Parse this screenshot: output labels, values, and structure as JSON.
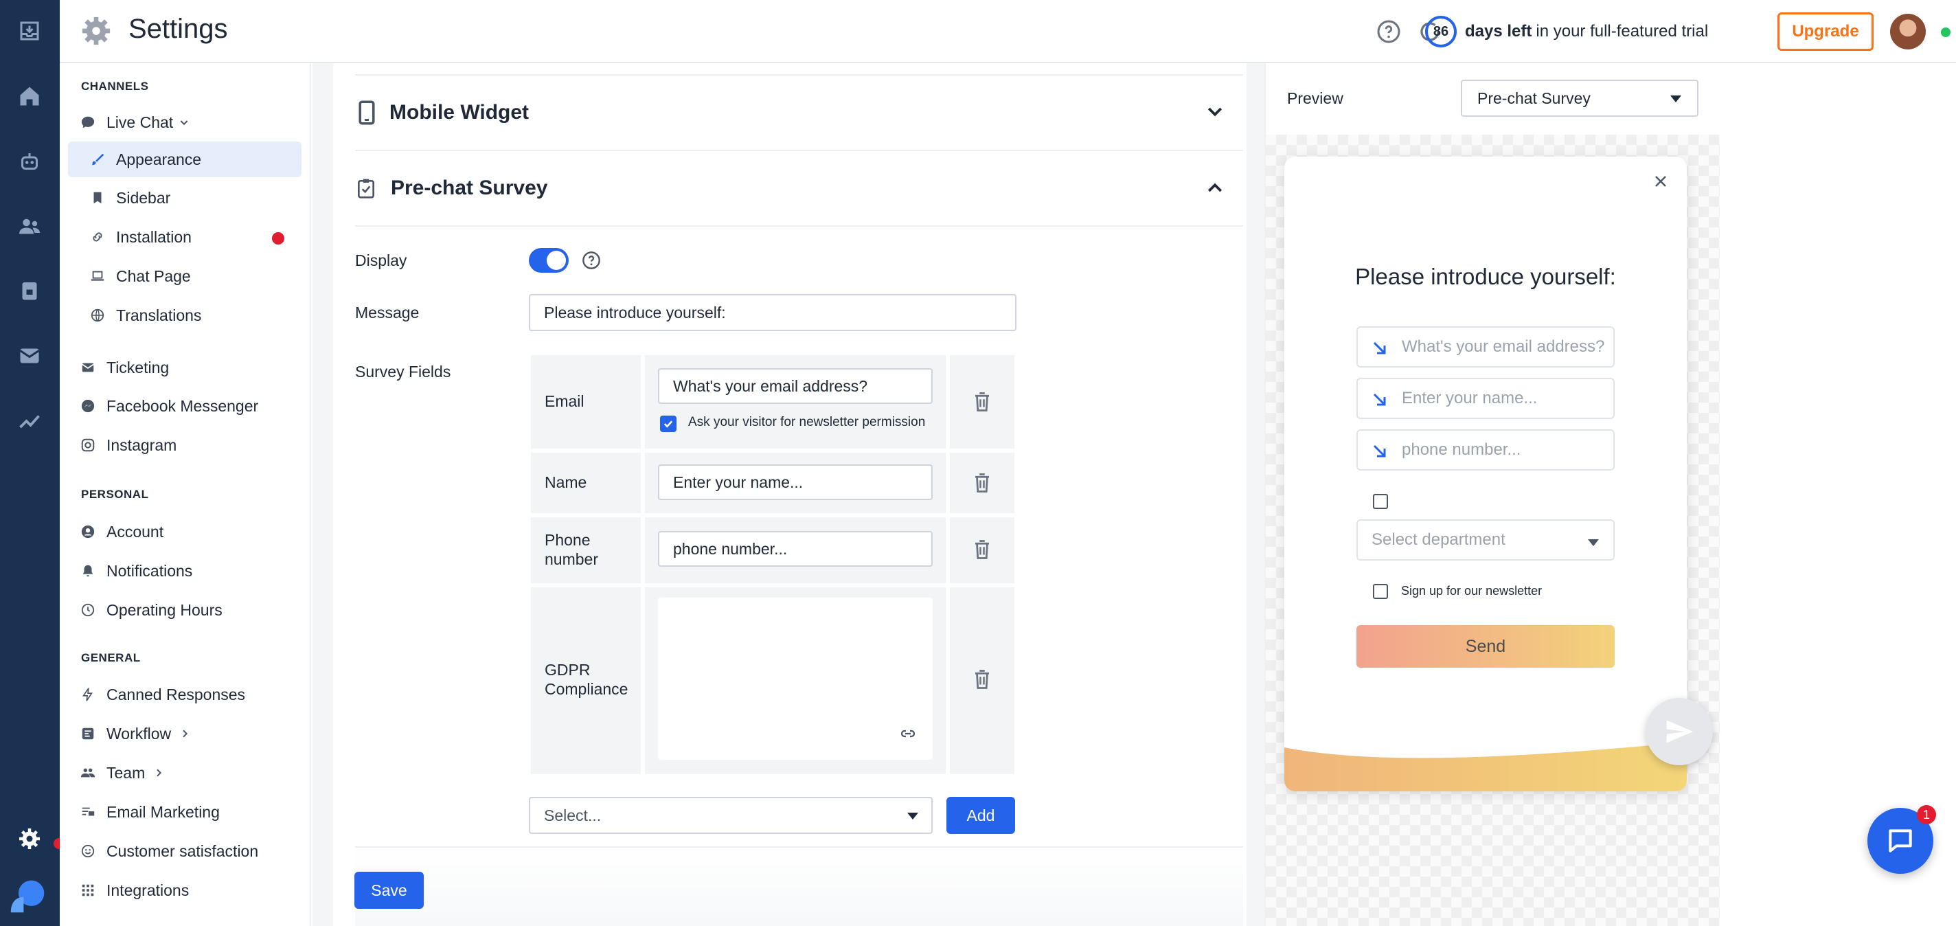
{
  "header": {
    "title": "Settings",
    "trial_days": "86",
    "trial_bold": "days left",
    "trial_rest": "in your full-featured trial",
    "upgrade_label": "Upgrade"
  },
  "sidebar": {
    "sections": {
      "channels": "CHANNELS",
      "personal": "PERSONAL",
      "general": "GENERAL"
    },
    "live_chat": "Live Chat",
    "live_chat_items": [
      "Appearance",
      "Sidebar",
      "Installation",
      "Chat Page",
      "Translations"
    ],
    "channels_items": [
      "Ticketing",
      "Facebook Messenger",
      "Instagram"
    ],
    "personal_items": [
      "Account",
      "Notifications",
      "Operating Hours"
    ],
    "general_items": [
      "Canned Responses",
      "Workflow",
      "Team",
      "Email Marketing",
      "Customer satisfaction",
      "Integrations"
    ]
  },
  "main": {
    "mobile_widget": "Mobile Widget",
    "prechat_survey": "Pre-chat Survey",
    "display_label": "Display",
    "message_label": "Message",
    "message_value": "Please introduce yourself:",
    "survey_fields_label": "Survey Fields",
    "fields": {
      "email": {
        "label": "Email",
        "placeholder": "What's your email address?",
        "newsletter": "Ask your visitor for newsletter permission"
      },
      "name": {
        "label": "Name",
        "placeholder": "Enter your name..."
      },
      "phone": {
        "label": "Phone number",
        "placeholder": "phone number..."
      },
      "gdpr": {
        "label": "GDPR Compliance"
      }
    },
    "select_placeholder": "Select...",
    "add_label": "Add",
    "save_label": "Save"
  },
  "preview": {
    "label": "Preview",
    "selected": "Pre-chat Survey",
    "heading": "Please introduce yourself:",
    "email_ph": "What's your email address?",
    "name_ph": "Enter your name...",
    "phone_ph": "phone number...",
    "department_ph": "Select department",
    "newsletter_label": "Sign up for our newsletter",
    "send_label": "Send"
  },
  "chat_widget": {
    "badge_count": "1"
  },
  "colors": {
    "accent": "#2563eb",
    "rail": "#1b3152",
    "upgrade": "#f97316",
    "alert": "#e11d2f"
  }
}
